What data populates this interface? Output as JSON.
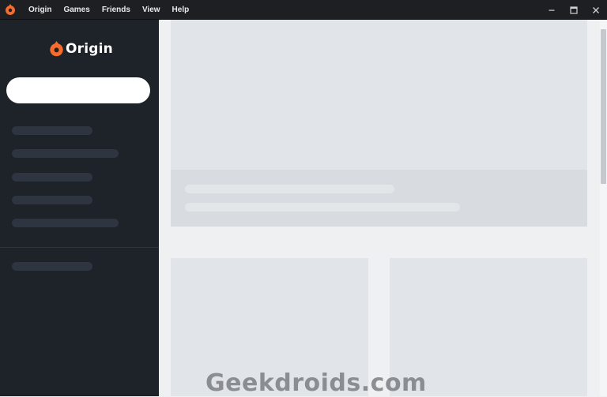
{
  "titlebar": {
    "icon": "origin-logo-icon",
    "menu": [
      "Origin",
      "Games",
      "Friends",
      "View",
      "Help"
    ],
    "controls": [
      "minimize-icon",
      "maximize-icon",
      "close-icon"
    ]
  },
  "sidebar": {
    "logo_text": "Origin",
    "search": {
      "value": "",
      "placeholder": ""
    }
  },
  "colors": {
    "brand": "#f56c2d",
    "sidebar_bg": "#1e2229",
    "titlebar_bg": "#1e1f23",
    "content_bg": "#eef0f2",
    "skeleton_dark": "#2f3540",
    "skeleton_light": "#e1e4e8"
  },
  "watermark": "Geekdroids.com"
}
